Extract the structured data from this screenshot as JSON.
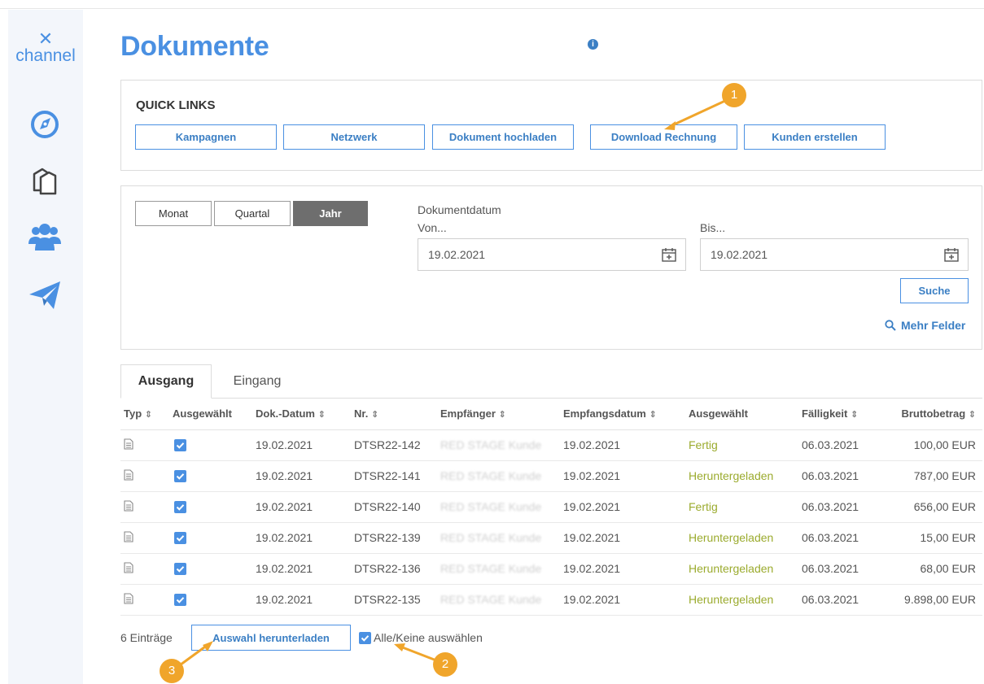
{
  "sidebar": {
    "logo_mark": "✕",
    "logo_text": "channel",
    "items": [
      {
        "name": "compass"
      },
      {
        "name": "documents"
      },
      {
        "name": "users"
      },
      {
        "name": "send"
      }
    ]
  },
  "page": {
    "title": "Dokumente"
  },
  "quick_links": {
    "label": "QUICK LINKS",
    "info_glyph": "i",
    "buttons": [
      "Kampagnen",
      "Netzwerk",
      "Dokument hochladen",
      "Download Rechnung",
      "Kunden erstellen"
    ]
  },
  "filter": {
    "periods": [
      "Monat",
      "Quartal",
      "Jahr"
    ],
    "active_period": "Jahr",
    "date_label": "Dokumentdatum",
    "from_label": "Von...",
    "to_label": "Bis...",
    "from_value": "19.02.2021",
    "to_value": "19.02.2021",
    "search_label": "Suche",
    "more_fields_label": "Mehr Felder"
  },
  "tabs": [
    "Ausgang",
    "Eingang"
  ],
  "table": {
    "columns": [
      "Typ",
      "Ausgewählt",
      "Dok.-Datum",
      "Nr.",
      "Empfänger",
      "Empfangsdatum",
      "Ausgewählt",
      "Fälligkeit",
      "Bruttobetrag"
    ],
    "rows": [
      {
        "doc_date": "19.02.2021",
        "nr": "DTSR22-142",
        "recipient": "RED STAGE Kunde",
        "received": "19.02.2021",
        "status": "Fertig",
        "due": "06.03.2021",
        "amount": "100,00 EUR"
      },
      {
        "doc_date": "19.02.2021",
        "nr": "DTSR22-141",
        "recipient": "RED STAGE Kunde",
        "received": "19.02.2021",
        "status": "Heruntergeladen",
        "due": "06.03.2021",
        "amount": "787,00 EUR"
      },
      {
        "doc_date": "19.02.2021",
        "nr": "DTSR22-140",
        "recipient": "RED STAGE Kunde",
        "received": "19.02.2021",
        "status": "Fertig",
        "due": "06.03.2021",
        "amount": "656,00 EUR"
      },
      {
        "doc_date": "19.02.2021",
        "nr": "DTSR22-139",
        "recipient": "RED STAGE Kunde",
        "received": "19.02.2021",
        "status": "Heruntergeladen",
        "due": "06.03.2021",
        "amount": "15,00 EUR"
      },
      {
        "doc_date": "19.02.2021",
        "nr": "DTSR22-136",
        "recipient": "RED STAGE Kunde",
        "received": "19.02.2021",
        "status": "Heruntergeladen",
        "due": "06.03.2021",
        "amount": "68,00 EUR"
      },
      {
        "doc_date": "19.02.2021",
        "nr": "DTSR22-135",
        "recipient": "RED STAGE Kunde",
        "received": "19.02.2021",
        "status": "Heruntergeladen",
        "due": "06.03.2021",
        "amount": "9.898,00 EUR"
      }
    ]
  },
  "footer": {
    "count": "6 Einträge",
    "download_selection": "Auswahl herunterladen",
    "select_all": "Alle/Keine auswählen"
  },
  "annotations": [
    "1",
    "2",
    "3"
  ],
  "colors": {
    "brand": "#4a90e2",
    "status": "#9bab2e",
    "annotation": "#f0a52b"
  }
}
